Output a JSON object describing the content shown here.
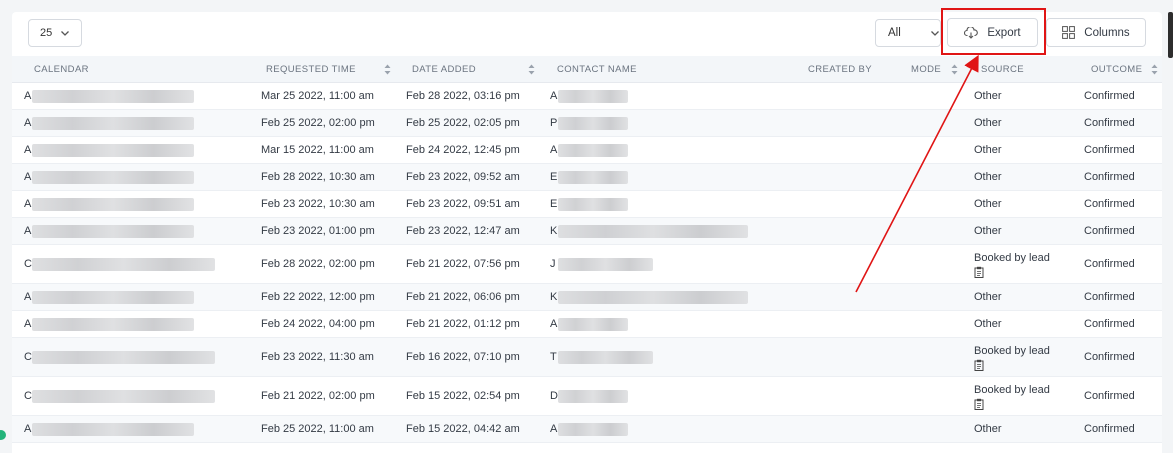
{
  "toolbar": {
    "per_page": "25",
    "filter": "All",
    "export_label": "Export",
    "columns_label": "Columns"
  },
  "columns": [
    "CALENDAR",
    "REQUESTED TIME",
    "DATE ADDED",
    "CONTACT NAME",
    "CREATED BY",
    "MODE",
    "SOURCE",
    "OUTCOME"
  ],
  "rows": [
    {
      "calendar": "A",
      "requested": "Mar 25 2022, 11:00 am",
      "added": "Feb 28 2022, 03:16 pm",
      "contact": "A",
      "source": "Other",
      "outcome": "Confirmed"
    },
    {
      "calendar": "A",
      "requested": "Feb 25 2022, 02:00 pm",
      "added": "Feb 25 2022, 02:05 pm",
      "contact": "P",
      "source": "Other",
      "outcome": "Confirmed"
    },
    {
      "calendar": "A",
      "requested": "Mar 15 2022, 11:00 am",
      "added": "Feb 24 2022, 12:45 pm",
      "contact": "A",
      "source": "Other",
      "outcome": "Confirmed"
    },
    {
      "calendar": "A",
      "requested": "Feb 28 2022, 10:30 am",
      "added": "Feb 23 2022, 09:52 am",
      "contact": "E",
      "source": "Other",
      "outcome": "Confirmed"
    },
    {
      "calendar": "A",
      "requested": "Feb 23 2022, 10:30 am",
      "added": "Feb 23 2022, 09:51 am",
      "contact": "E",
      "source": "Other",
      "outcome": "Confirmed"
    },
    {
      "calendar": "A",
      "requested": "Feb 23 2022, 01:00 pm",
      "added": "Feb 23 2022, 12:47 am",
      "contact": "K",
      "source": "Other",
      "outcome": "Confirmed"
    },
    {
      "calendar": "C",
      "requested": "Feb 28 2022, 02:00 pm",
      "added": "Feb 21 2022, 07:56 pm",
      "contact": "J",
      "source": "Booked by lead",
      "outcome": "Confirmed"
    },
    {
      "calendar": "A",
      "requested": "Feb 22 2022, 12:00 pm",
      "added": "Feb 21 2022, 06:06 pm",
      "contact": "K",
      "source": "Other",
      "outcome": "Confirmed"
    },
    {
      "calendar": "A",
      "requested": "Feb 24 2022, 04:00 pm",
      "added": "Feb 21 2022, 01:12 pm",
      "contact": "A",
      "source": "Other",
      "outcome": "Confirmed"
    },
    {
      "calendar": "C",
      "requested": "Feb 23 2022, 11:30 am",
      "added": "Feb 16 2022, 07:10 pm",
      "contact": "T",
      "source": "Booked by lead",
      "outcome": "Confirmed"
    },
    {
      "calendar": "C",
      "requested": "Feb 21 2022, 02:00 pm",
      "added": "Feb 15 2022, 02:54 pm",
      "contact": "D",
      "source": "Booked by lead",
      "outcome": "Confirmed"
    },
    {
      "calendar": "A",
      "requested": "Feb 25 2022, 11:00 am",
      "added": "Feb 15 2022, 04:42 am",
      "contact": "A",
      "source": "Other",
      "outcome": "Confirmed"
    }
  ],
  "icons": {
    "dropdown": "chevron-down-icon",
    "export": "cloud-download-icon",
    "columns": "columns-grid-icon",
    "sort": "sort-icon",
    "booked": "clipboard-icon"
  },
  "colors": {
    "highlight": "#e01515",
    "status_dot": "#23b37a"
  }
}
